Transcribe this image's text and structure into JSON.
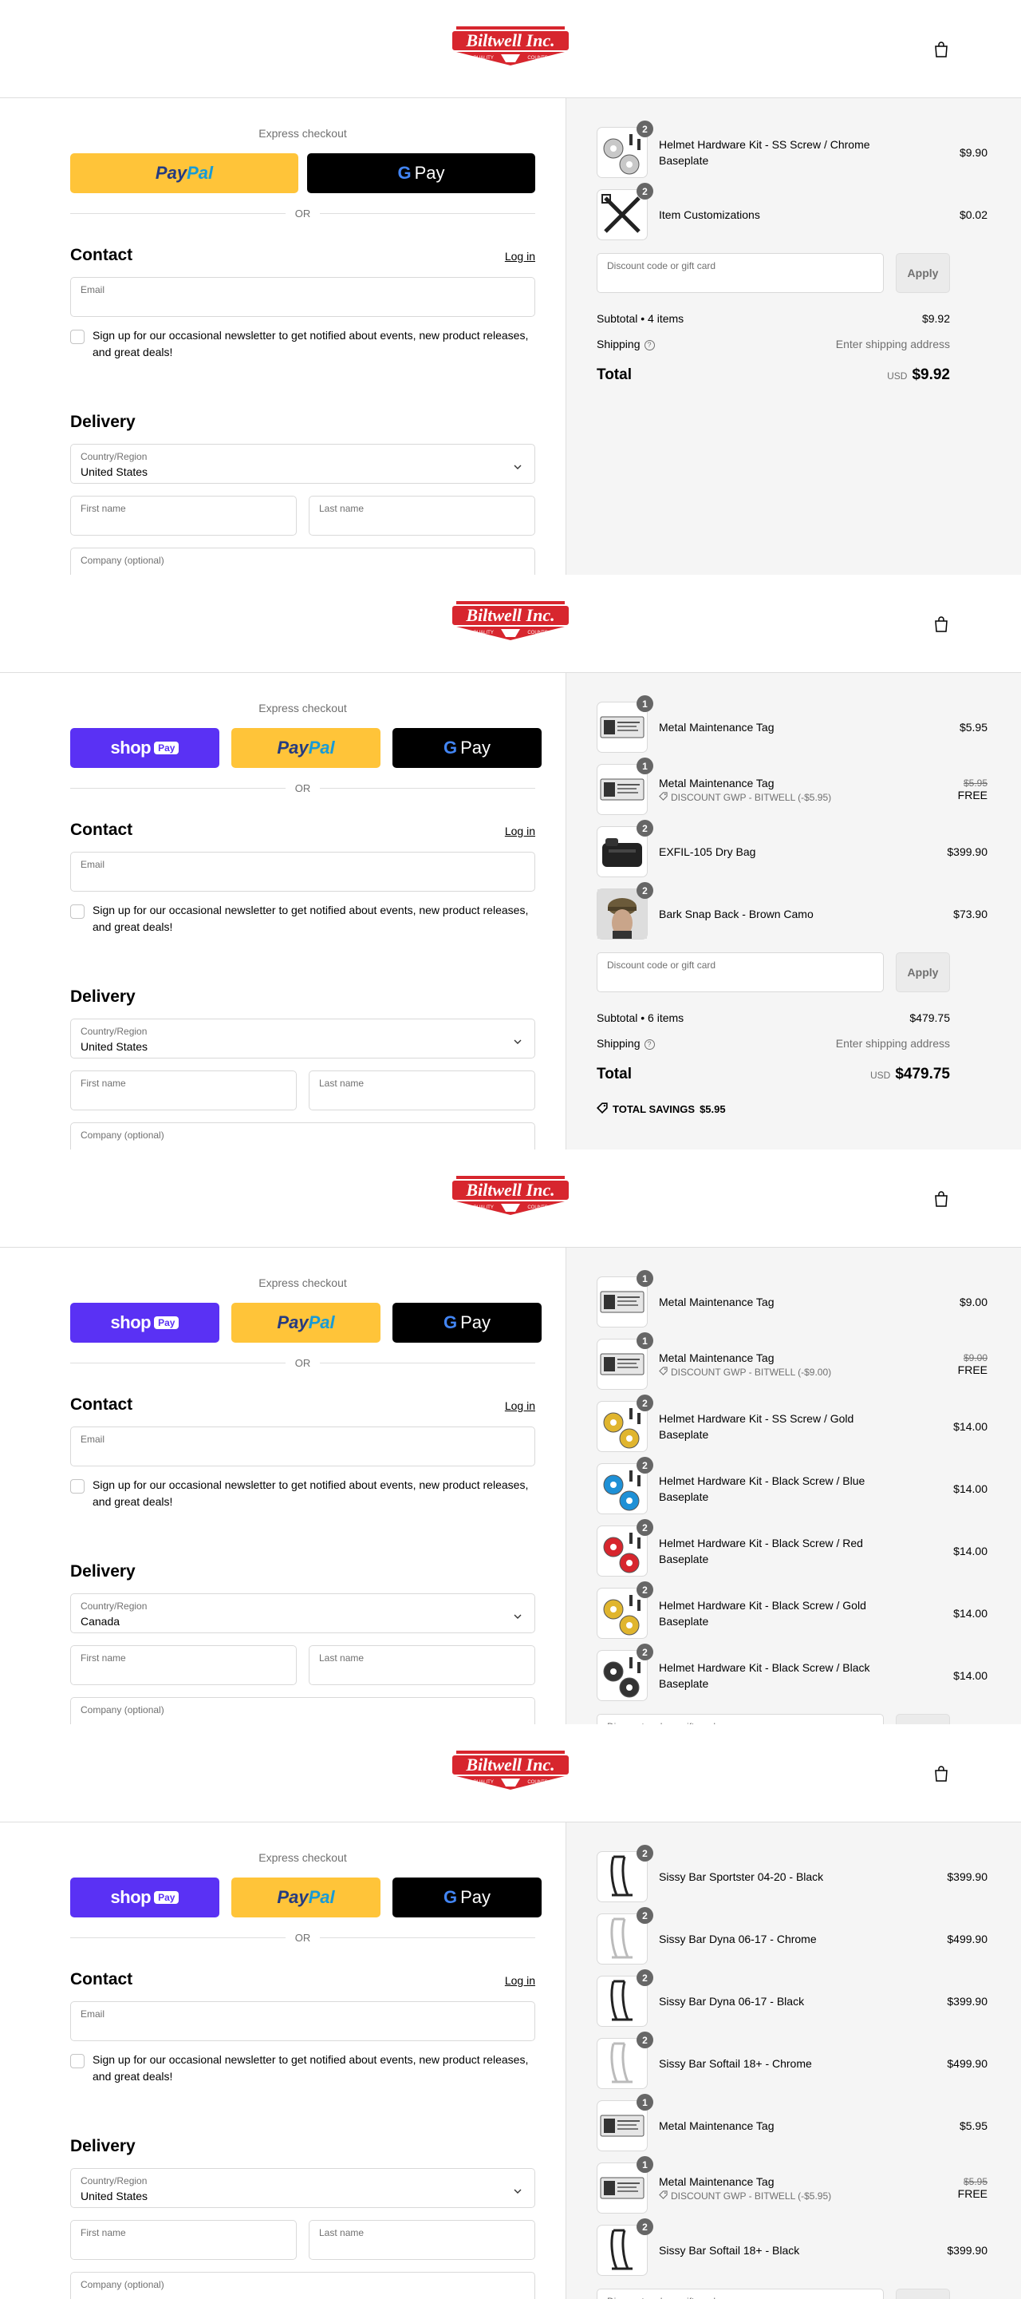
{
  "brand": {
    "name": "Biltwell Inc.",
    "tag_left": "QUALITY",
    "tag_right": "COUNTS",
    "red": "#d7262e"
  },
  "common": {
    "express": "Express checkout",
    "paypal_a": "Pay",
    "paypal_b": "Pal",
    "gpay": "Pay",
    "shop": "shop",
    "shop_pay": "Pay",
    "or": "OR",
    "contact": "Contact",
    "login": "Log in",
    "email_label": "Email",
    "newsletter": "Sign up for our occasional newsletter to get notified about events, new product releases, and great deals!",
    "delivery": "Delivery",
    "country_label": "Country/Region",
    "first_name": "First name",
    "last_name": "Last name",
    "company": "Company (optional)",
    "discount_label": "Discount code or gift card",
    "apply": "Apply",
    "shipping": "Shipping",
    "shipping_value": "Enter shipping address",
    "total": "Total",
    "currency": "USD"
  },
  "panels": [
    {
      "country": "United States",
      "items": [
        {
          "qty": "2",
          "name": "Helmet Hardware Kit - SS Screw / Chrome Baseplate",
          "price": "$9.90",
          "thumb": "chrome-hardware-icon"
        },
        {
          "qty": "2",
          "name": "Item Customizations",
          "price": "$0.02",
          "thumb": "tools-icon"
        }
      ],
      "subtotal_label": "Subtotal • 4 items",
      "subtotal": "$9.92",
      "total": "$9.92"
    },
    {
      "country": "United States",
      "items": [
        {
          "qty": "1",
          "name": "Metal Maintenance Tag",
          "price": "$5.95",
          "thumb": "tag-icon"
        },
        {
          "qty": "1",
          "name": "Metal Maintenance Tag",
          "discount": "DISCOUNT GWP - BITWELL (-$5.95)",
          "old_price": "$5.95",
          "price": "FREE",
          "thumb": "tag-icon"
        },
        {
          "qty": "2",
          "name": "EXFIL-105 Dry Bag",
          "price": "$399.90",
          "thumb": "bag-icon"
        },
        {
          "qty": "2",
          "name": "Bark Snap Back - Brown Camo",
          "price": "$73.90",
          "thumb": "hat-icon"
        }
      ],
      "subtotal_label": "Subtotal • 6 items",
      "subtotal": "$479.75",
      "total": "$479.75",
      "savings_label": "TOTAL SAVINGS",
      "savings": "$5.95"
    },
    {
      "country": "Canada",
      "items": [
        {
          "qty": "1",
          "name": "Metal Maintenance Tag",
          "price": "$9.00",
          "thumb": "tag-icon"
        },
        {
          "qty": "1",
          "name": "Metal Maintenance Tag",
          "discount": "DISCOUNT GWP - BITWELL (-$9.00)",
          "old_price": "$9.00",
          "price": "FREE",
          "thumb": "tag-icon"
        },
        {
          "qty": "2",
          "name": "Helmet Hardware Kit - SS Screw / Gold Baseplate",
          "price": "$14.00",
          "thumb": "gold-hardware-icon"
        },
        {
          "qty": "2",
          "name": "Helmet Hardware Kit - Black Screw / Blue Baseplate",
          "price": "$14.00",
          "thumb": "blue-hardware-icon"
        },
        {
          "qty": "2",
          "name": "Helmet Hardware Kit - Black Screw / Red Baseplate",
          "price": "$14.00",
          "thumb": "red-hardware-icon"
        },
        {
          "qty": "2",
          "name": "Helmet Hardware Kit - Black Screw / Gold Baseplate",
          "price": "$14.00",
          "thumb": "gold-hardware-icon"
        },
        {
          "qty": "2",
          "name": "Helmet Hardware Kit - Black Screw / Black Baseplate",
          "price": "$14.00",
          "thumb": "black-hardware-icon"
        }
      ]
    },
    {
      "country": "United States",
      "items": [
        {
          "qty": "2",
          "name": "Sissy Bar Sportster 04-20 - Black",
          "price": "$399.90",
          "thumb": "sissy-bar-black-icon"
        },
        {
          "qty": "2",
          "name": "Sissy Bar Dyna 06-17 - Chrome",
          "price": "$499.90",
          "thumb": "sissy-bar-chrome-icon"
        },
        {
          "qty": "2",
          "name": "Sissy Bar Dyna 06-17 - Black",
          "price": "$399.90",
          "thumb": "sissy-bar-black-icon"
        },
        {
          "qty": "2",
          "name": "Sissy Bar Softail 18+ - Chrome",
          "price": "$499.90",
          "thumb": "sissy-bar-chrome-icon"
        },
        {
          "qty": "1",
          "name": "Metal Maintenance Tag",
          "price": "$5.95",
          "thumb": "tag-icon"
        },
        {
          "qty": "1",
          "name": "Metal Maintenance Tag",
          "discount": "DISCOUNT GWP - BITWELL (-$5.95)",
          "old_price": "$5.95",
          "price": "FREE",
          "thumb": "tag-icon"
        },
        {
          "qty": "2",
          "name": "Sissy Bar Softail 18+ - Black",
          "price": "$399.90",
          "thumb": "sissy-bar-black-icon"
        }
      ]
    }
  ]
}
